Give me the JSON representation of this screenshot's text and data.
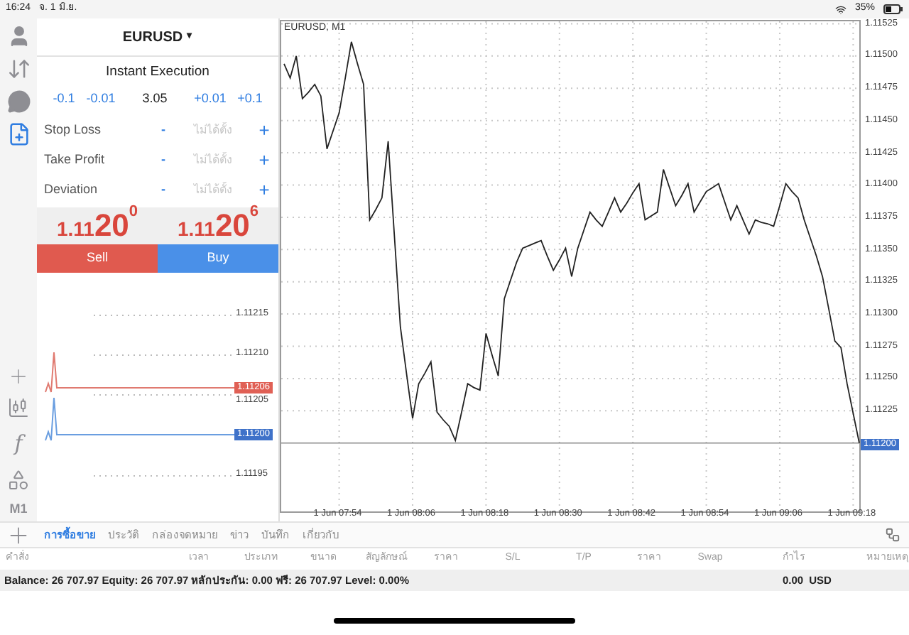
{
  "status_bar": {
    "time": "16:24",
    "date": "จ. 1 มิ.ย.",
    "battery": "35%"
  },
  "toolbar": {
    "top": [
      {
        "kind": "account",
        "selected": false
      },
      {
        "kind": "trade",
        "selected": false
      },
      {
        "kind": "chat",
        "selected": false
      },
      {
        "kind": "new-order",
        "selected": true
      }
    ],
    "bottom": [
      {
        "kind": "crosshair"
      },
      {
        "kind": "candles"
      },
      {
        "kind": "text",
        "text": "f"
      },
      {
        "kind": "objects"
      },
      {
        "kind": "text",
        "text": "M1"
      },
      {
        "kind": "add"
      }
    ]
  },
  "order": {
    "symbol": "EURUSD",
    "symbol_caret": "▾",
    "execution": "Instant Execution",
    "volume": {
      "steps_down": [
        "-0.1",
        "-0.01"
      ],
      "value": "3.05",
      "steps_up": [
        "+0.01",
        "+0.1"
      ]
    },
    "fields": [
      {
        "label": "Stop Loss",
        "minus": "-",
        "placeholder": "ไม่ได้ตั้ง",
        "plus": "+"
      },
      {
        "label": "Take Profit",
        "minus": "-",
        "placeholder": "ไม่ได้ตั้ง",
        "plus": "+"
      },
      {
        "label": "Deviation",
        "minus": "-",
        "placeholder": "ไม่ได้ตั้ง",
        "plus": "+"
      }
    ],
    "prices": [
      {
        "prefix": "1.11",
        "big": "20",
        "sup": "0",
        "color": "#d9463c"
      },
      {
        "prefix": "1.11",
        "big": "20",
        "sup": "6",
        "color": "#d9463c"
      }
    ],
    "buttons": [
      {
        "label": "Sell",
        "color": "#e05a4f"
      },
      {
        "label": "Buy",
        "color": "#4a90e8"
      }
    ],
    "mini_chart": {
      "price_labels": [
        "1.11215",
        "1.11210",
        "1.11205",
        "1.11195"
      ],
      "ask_tag": "1.11206",
      "bid_tag": "1.11200"
    }
  },
  "chart": {
    "title": "EURUSD, M1",
    "chart_data": {
      "type": "line",
      "grid": true,
      "ylim": [
        1.11147,
        1.11528
      ],
      "ref_lines": [
        {
          "axis": "y",
          "value": 1.112,
          "label": "1.11200",
          "color": "#8a8a8a"
        }
      ],
      "categories": [
        null,
        null,
        null,
        null,
        null,
        null,
        null,
        null,
        null,
        "1 Jun 07:54",
        null,
        null,
        null,
        null,
        null,
        null,
        null,
        null,
        null,
        null,
        null,
        "1 Jun 08:06",
        null,
        null,
        null,
        null,
        null,
        null,
        null,
        null,
        null,
        null,
        null,
        "1 Jun 08:18",
        null,
        null,
        null,
        null,
        null,
        null,
        null,
        null,
        null,
        null,
        null,
        "1 Jun 08:30",
        null,
        null,
        null,
        null,
        null,
        null,
        null,
        null,
        null,
        null,
        null,
        "1 Jun 08:42",
        null,
        null,
        null,
        null,
        null,
        null,
        null,
        null,
        null,
        null,
        null,
        "1 Jun 08:54",
        null,
        null,
        null,
        null,
        null,
        null,
        null,
        null,
        null,
        null,
        null,
        "1 Jun 09:06",
        null,
        null,
        null,
        null,
        null,
        null,
        null,
        null,
        null,
        null,
        null,
        "1 Jun 09:18",
        null
      ],
      "series": [
        {
          "color": "#222222",
          "values": [
            1.11494,
            1.11483,
            1.115,
            1.11467,
            1.11472,
            1.11478,
            1.11469,
            1.11428,
            1.11442,
            1.11456,
            1.11483,
            1.11511,
            1.11494,
            1.11478,
            1.11373,
            1.11381,
            1.1139,
            1.11434,
            1.11362,
            1.1129,
            1.11254,
            1.11219,
            1.11246,
            1.11254,
            1.11263,
            1.11224,
            1.11218,
            1.11213,
            1.11202,
            1.11224,
            1.11246,
            1.11243,
            1.11241,
            1.11285,
            1.11268,
            1.11252,
            1.11312,
            1.11326,
            1.1134,
            1.11351,
            1.11353,
            1.11355,
            1.11357,
            1.11345,
            1.11334,
            1.11342,
            1.11351,
            1.11329,
            1.11351,
            1.11365,
            1.11379,
            1.11373,
            1.11368,
            1.11379,
            1.1139,
            1.11379,
            1.11386,
            1.11394,
            1.11401,
            1.11373,
            1.11376,
            1.11379,
            1.11412,
            1.11398,
            1.11384,
            1.11392,
            1.11401,
            1.11379,
            1.11387,
            1.11395,
            1.11398,
            1.11401,
            1.11387,
            1.11373,
            1.11384,
            1.11373,
            1.11362,
            1.11373,
            1.11371,
            1.1137,
            1.11368,
            1.11384,
            1.11401,
            1.11395,
            1.1139,
            1.11373,
            1.11359,
            1.11345,
            1.11329,
            1.11304,
            1.11279,
            1.11274,
            1.11246,
            1.11223,
            1.112
          ]
        }
      ],
      "yticks": [
        {
          "value": 1.11225,
          "label": "1.11225"
        },
        {
          "value": 1.1125,
          "label": "1.11250"
        },
        {
          "value": 1.11275,
          "label": "1.11275"
        },
        {
          "value": 1.113,
          "label": "1.11300"
        },
        {
          "value": 1.11325,
          "label": "1.11325"
        },
        {
          "value": 1.1135,
          "label": "1.11350"
        },
        {
          "value": 1.11375,
          "label": "1.11375"
        },
        {
          "value": 1.114,
          "label": "1.11400"
        },
        {
          "value": 1.11425,
          "label": "1.11425"
        },
        {
          "value": 1.1145,
          "label": "1.11450"
        },
        {
          "value": 1.11475,
          "label": "1.11475"
        },
        {
          "value": 1.115,
          "label": "1.11500"
        },
        {
          "value": 1.11525,
          "label": "1.11525"
        }
      ]
    }
  },
  "tabs": [
    {
      "label": "การซื้อขาย",
      "selected": true
    },
    {
      "label": "ประวัติ",
      "selected": false
    },
    {
      "label": "กล่องจดหมาย",
      "selected": false
    },
    {
      "label": "ข่าว",
      "selected": false
    },
    {
      "label": "บันทึก",
      "selected": false
    },
    {
      "label": "เกี่ยวกับ",
      "selected": false
    }
  ],
  "table": {
    "columns": [
      "คำสั่ง",
      "เวลา",
      "ประเภท",
      "ขนาด",
      "สัญลักษณ์",
      "ราคา",
      "S/L",
      "T/P",
      "ราคา",
      "Swap",
      "กำไร",
      "หมายเหตุ"
    ]
  },
  "summary": {
    "text": "Balance: 26 707.97 Equity: 26 707.97 หลักประกัน: 0.00 ฟรี: 26 707.97 Level: 0.00%",
    "profit": "0.00",
    "currency": "USD"
  }
}
